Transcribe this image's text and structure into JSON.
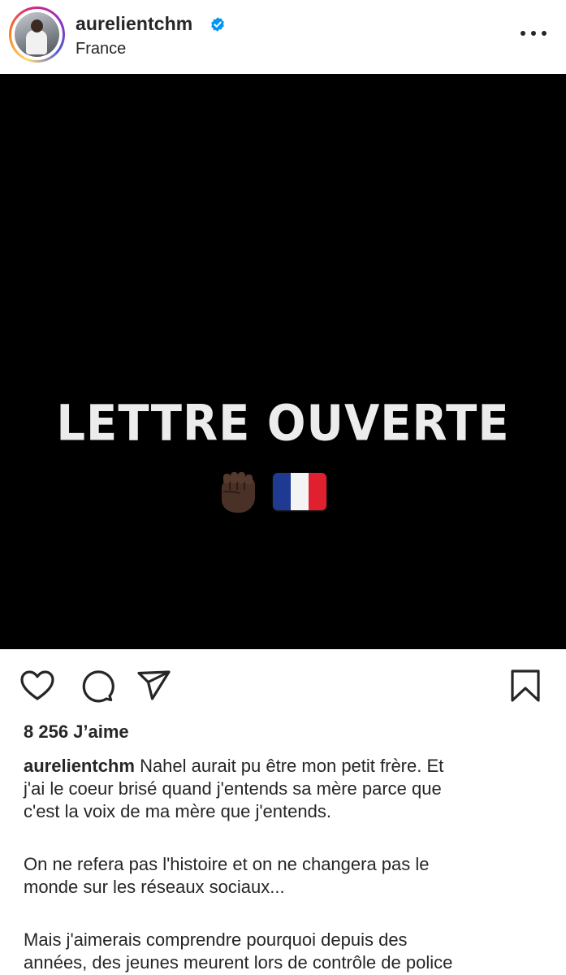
{
  "header": {
    "username": "aurelientchm",
    "location": "France",
    "verified": true
  },
  "post": {
    "image_title": "LETTRE OUVERTE",
    "image_emojis": [
      "raised-fist-dark-skin",
      "flag-france"
    ],
    "likes": "8 256 J’aime",
    "caption_user": "aurelientchm",
    "caption_lines": [
      "Nahel aurait pu être mon petit frère. Et",
      "j'ai le coeur brisé quand j'entends sa mère parce que",
      "c'est la voix de ma mère que j'entends."
    ],
    "paragraph2": [
      "On ne refera pas l'histoire et on ne changera pas le",
      "monde sur les réseaux sociaux..."
    ],
    "paragraph3": [
      "Mais j'aimerais comprendre pourquoi depuis des",
      "années, des jeunes meurent lors de contrôle de police"
    ]
  },
  "icons": {
    "like": "heart-icon",
    "comment": "comment-icon",
    "share": "send-icon",
    "save": "bookmark-icon",
    "more": "more-options-icon",
    "verified": "verified-badge-icon"
  },
  "colors": {
    "verified_blue": "#0095f6",
    "text": "#262626",
    "flag_blue": "#1f3a93",
    "flag_white": "#f4f4f4",
    "flag_red": "#e0202e"
  }
}
